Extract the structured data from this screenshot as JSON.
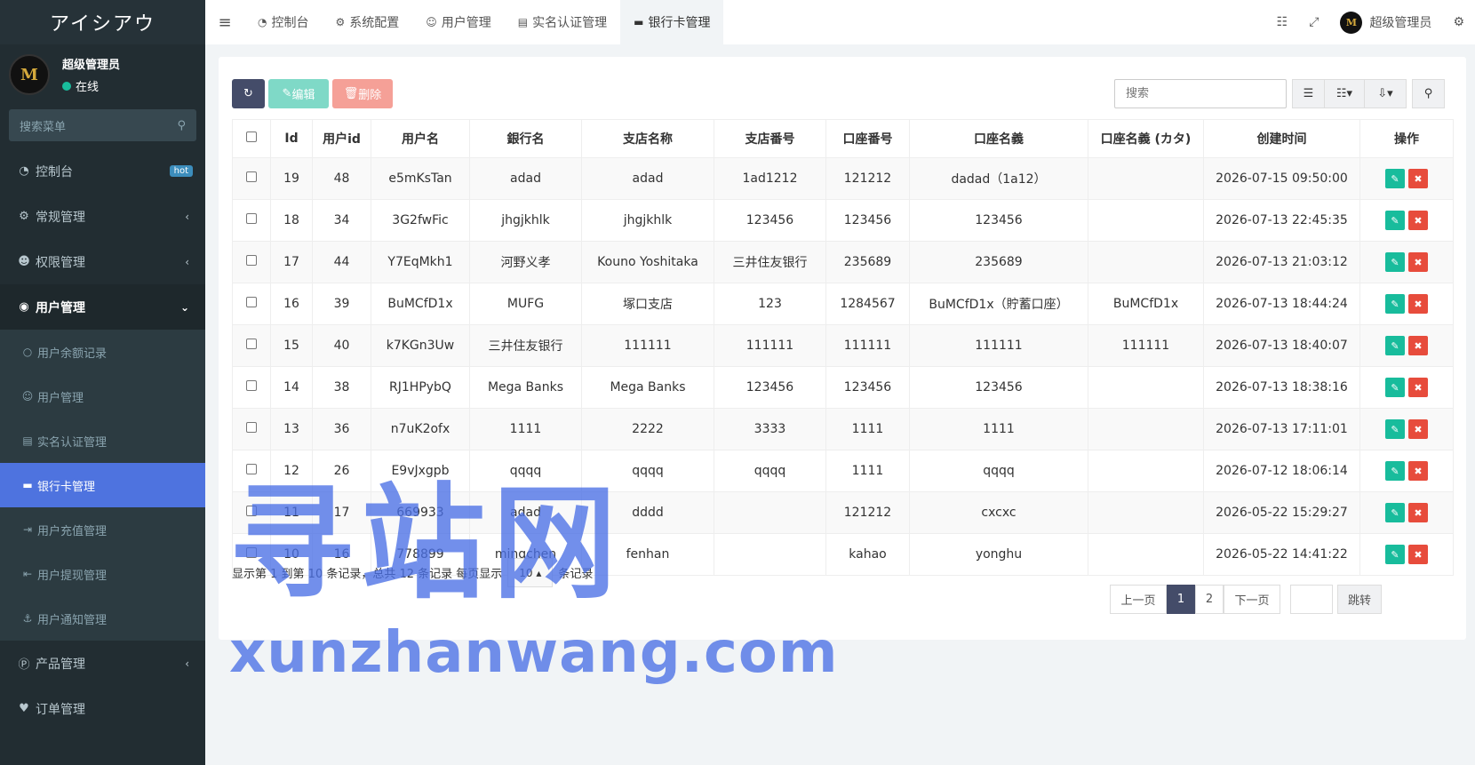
{
  "app": {
    "logo": "アイシアウ",
    "avatar_letter": "M"
  },
  "user": {
    "name": "超级管理员",
    "status": "在线"
  },
  "sidebar": {
    "search_placeholder": "搜索菜单",
    "menu": [
      {
        "label": "控制台",
        "icon": "dashboard-icon",
        "badge": "hot"
      },
      {
        "label": "常规管理",
        "icon": "cogs-icon"
      },
      {
        "label": "权限管理",
        "icon": "group-icon"
      },
      {
        "label": "用户管理",
        "icon": "user-circle-icon"
      }
    ],
    "submenu": [
      {
        "label": "用户余额记录",
        "icon": "circle-icon"
      },
      {
        "label": "用户管理",
        "icon": "user-icon"
      },
      {
        "label": "实名认证管理",
        "icon": "id-card-icon"
      },
      {
        "label": "银行卡管理",
        "icon": "credit-card-icon"
      },
      {
        "label": "用户充值管理",
        "icon": "sign-in-icon"
      },
      {
        "label": "用户提现管理",
        "icon": "sign-out-icon"
      },
      {
        "label": "用户通知管理",
        "icon": "anchor-icon"
      }
    ],
    "menu_after": [
      {
        "label": "产品管理",
        "icon": "product-icon"
      },
      {
        "label": "订单管理",
        "icon": "heartbeat-icon"
      }
    ]
  },
  "topnav": {
    "tabs": [
      "控制台",
      "系统配置",
      "用户管理",
      "实名认证管理",
      "银行卡管理"
    ],
    "admin": "超级管理员"
  },
  "toolbar": {
    "edit": "编辑",
    "delete": "删除",
    "search_placeholder": "搜索"
  },
  "table": {
    "headers": [
      "Id",
      "用户id",
      "用户名",
      "銀行名",
      "支店名称",
      "支店番号",
      "口座番号",
      "口座名義",
      "口座名義 (カタ)",
      "创建时间",
      "操作"
    ],
    "rows": [
      [
        "19",
        "48",
        "e5mKsTan",
        "adad",
        "adad",
        "1ad1212",
        "121212",
        "dadad（1a12）",
        "",
        "2026-07-15 09:50:00"
      ],
      [
        "18",
        "34",
        "3G2fwFic",
        "jhgjkhlk",
        "jhgjkhlk",
        "123456",
        "123456",
        "123456",
        "",
        "2026-07-13 22:45:35"
      ],
      [
        "17",
        "44",
        "Y7EqMkh1",
        "河野义孝",
        "Kouno Yoshitaka",
        "三井住友银行",
        "235689",
        "235689",
        "",
        "2026-07-13 21:03:12"
      ],
      [
        "16",
        "39",
        "BuMCfD1x",
        "MUFG",
        "塚口支店",
        "123",
        "1284567",
        "BuMCfD1x（貯蓄口座）",
        "BuMCfD1x",
        "2026-07-13 18:44:24"
      ],
      [
        "15",
        "40",
        "k7KGn3Uw",
        "三井住友银行",
        "111111",
        "111111",
        "111111",
        "111111",
        "111111",
        "2026-07-13 18:40:07"
      ],
      [
        "14",
        "38",
        "RJ1HPybQ",
        "Mega Banks",
        "Mega Banks",
        "123456",
        "123456",
        "123456",
        "",
        "2026-07-13 18:38:16"
      ],
      [
        "13",
        "36",
        "n7uK2ofx",
        "1111",
        "2222",
        "3333",
        "1111",
        "1111",
        "",
        "2026-07-13 17:11:01"
      ],
      [
        "12",
        "26",
        "E9vJxgpb",
        "qqqq",
        "qqqq",
        "qqqq",
        "1111",
        "qqqq",
        "",
        "2026-07-12 18:06:14"
      ],
      [
        "11",
        "17",
        "669933",
        "adad",
        "dddd",
        "",
        "121212",
        "cxcxc",
        "",
        "2026-05-22 15:29:27"
      ],
      [
        "10",
        "16",
        "778899",
        "mingchen",
        "fenhan",
        "",
        "kahao",
        "yonghu",
        "",
        "2026-05-22 14:41:22"
      ]
    ]
  },
  "footer": {
    "info_prefix": "显示第 1 到第 10 条记录，总共 12 条记录 每页显示",
    "page_size": "10",
    "info_suffix": "条记录"
  },
  "pager": {
    "prev": "上一页",
    "pages": [
      "1",
      "2"
    ],
    "next": "下一页",
    "jump": "跳转"
  },
  "watermark": {
    "cn": "寻站网",
    "en": "xunzhanwang.com"
  }
}
